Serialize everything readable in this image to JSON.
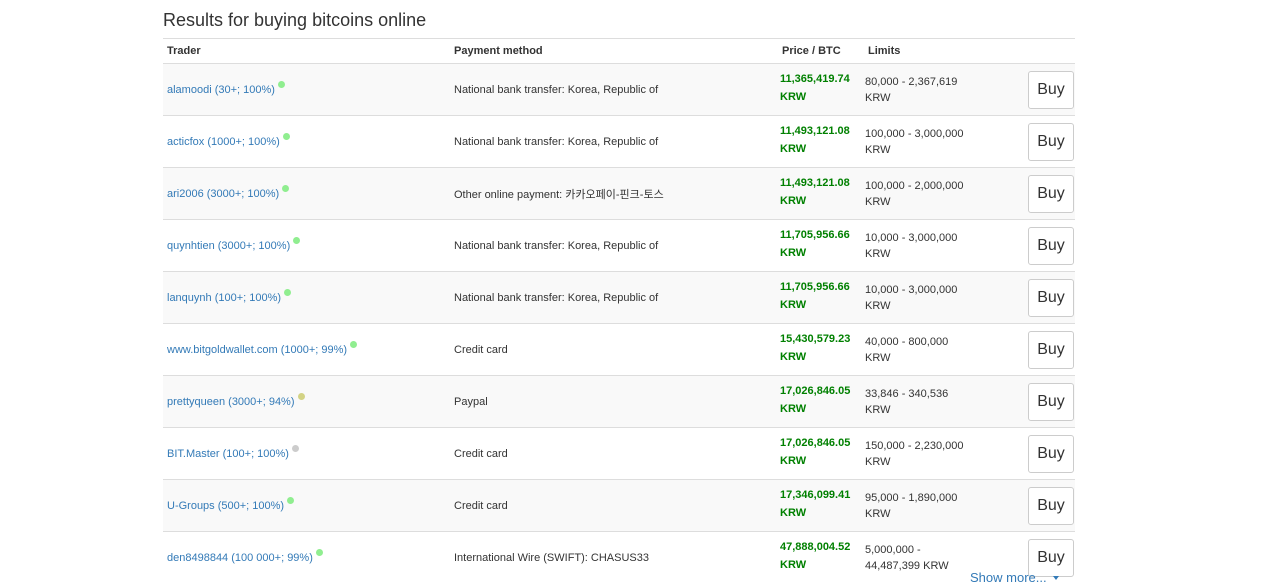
{
  "title": "Results for buying bitcoins online",
  "columns": {
    "trader": "Trader",
    "payment": "Payment method",
    "price": "Price / BTC",
    "limits": "Limits"
  },
  "buy_label": "Buy",
  "show_more": "Show more...",
  "status_colors": {
    "online": "#90ee90",
    "recent": "#d3d385",
    "offline": "#cccccc"
  },
  "rows": [
    {
      "trader": "alamoodi (30+; 100%)",
      "status": "online",
      "payment": "National bank transfer: Korea, Republic of",
      "price": "11,365,419.74",
      "currency": "KRW",
      "limit_range": "80,000 - 2,367,619",
      "limit_currency": "KRW"
    },
    {
      "trader": "acticfox (1000+; 100%)",
      "status": "online",
      "payment": "National bank transfer: Korea, Republic of",
      "price": "11,493,121.08",
      "currency": "KRW",
      "limit_range": "100,000 - 3,000,000",
      "limit_currency": "KRW"
    },
    {
      "trader": "ari2006 (3000+; 100%)",
      "status": "online",
      "payment": "Other online payment: 카카오페이-핀크-토스",
      "price": "11,493,121.08",
      "currency": "KRW",
      "limit_range": "100,000 - 2,000,000",
      "limit_currency": "KRW"
    },
    {
      "trader": "quynhtien (3000+; 100%)",
      "status": "online",
      "payment": "National bank transfer: Korea, Republic of",
      "price": "11,705,956.66",
      "currency": "KRW",
      "limit_range": "10,000 - 3,000,000",
      "limit_currency": "KRW"
    },
    {
      "trader": "lanquynh (100+; 100%)",
      "status": "online",
      "payment": "National bank transfer: Korea, Republic of",
      "price": "11,705,956.66",
      "currency": "KRW",
      "limit_range": "10,000 - 3,000,000",
      "limit_currency": "KRW"
    },
    {
      "trader": "www.bitgoldwallet.com (1000+; 99%)",
      "status": "online",
      "payment": "Credit card",
      "price": "15,430,579.23",
      "currency": "KRW",
      "limit_range": "40,000 - 800,000",
      "limit_currency": "KRW"
    },
    {
      "trader": "prettyqueen (3000+; 94%)",
      "status": "recent",
      "payment": "Paypal",
      "price": "17,026,846.05",
      "currency": "KRW",
      "limit_range": "33,846 - 340,536",
      "limit_currency": "KRW"
    },
    {
      "trader": "BIT.Master (100+; 100%)",
      "status": "offline",
      "payment": "Credit card",
      "price": "17,026,846.05",
      "currency": "KRW",
      "limit_range": "150,000 - 2,230,000",
      "limit_currency": "KRW"
    },
    {
      "trader": "U-Groups (500+; 100%)",
      "status": "online",
      "payment": "Credit card",
      "price": "17,346,099.41",
      "currency": "KRW",
      "limit_range": "95,000 - 1,890,000",
      "limit_currency": "KRW"
    },
    {
      "trader": "den8498844 (100 000+; 99%)",
      "status": "online",
      "payment": "International Wire (SWIFT): CHASUS33",
      "price": "47,888,004.52",
      "currency": "KRW",
      "limit_range": "5,000,000 -",
      "limit_currency": "44,487,399 KRW"
    }
  ]
}
